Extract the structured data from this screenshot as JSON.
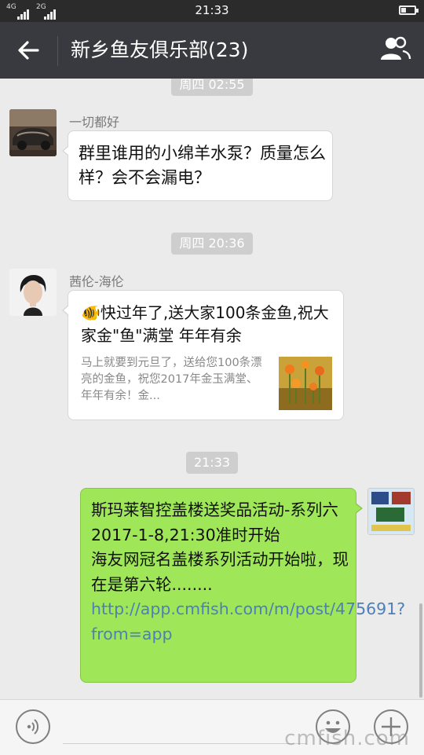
{
  "status_bar": {
    "network_left": "4G",
    "network_right": "2G",
    "time": "21:33"
  },
  "header": {
    "title": "新乡鱼友俱乐部(23)",
    "back_icon": "arrow-left-icon",
    "members_icon": "people-icon"
  },
  "chat": {
    "timestamps": [
      "周四 02:55",
      "周四 20:36",
      "21:33"
    ],
    "messages": [
      {
        "sender": "一切都好",
        "text": "群里谁用的小绵羊水泵？质量怎么样？会不会漏电？"
      },
      {
        "sender": "茜伦-海伦",
        "link_title": "🐠快过年了,送大家100条金鱼,祝大家金\"鱼\"满堂 年年有余",
        "link_desc": "马上就要到元旦了，送给您100条漂亮的金鱼，祝您2017年金玉满堂、年年有余！金..."
      },
      {
        "line1": "斯玛莱智控盖楼送奖品活动-系列六",
        "line2": "2017-1-8,21:30准时开始",
        "line3": "海友网冠名盖楼系列活动开始啦，现在是第六轮........",
        "url": "http://app.cmfish.com/m/post/475691?from=app"
      }
    ]
  },
  "bottom_bar": {
    "voice_icon": "voice-icon",
    "emoji_icon": "emoji-icon",
    "plus_icon": "plus-icon",
    "watermark": "cmfish.com"
  }
}
